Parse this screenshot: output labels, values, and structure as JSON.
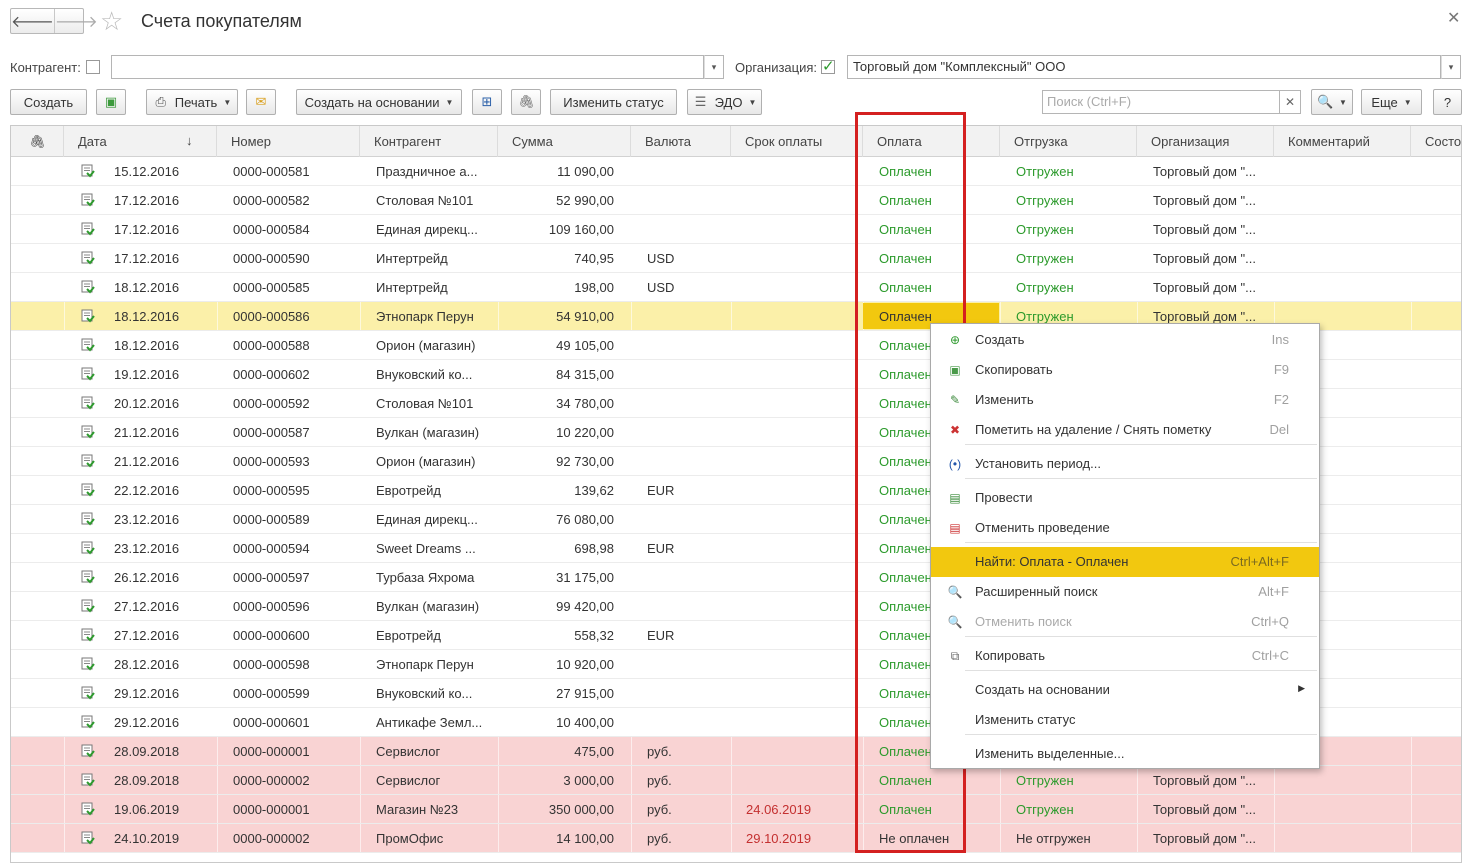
{
  "title": "Счета покупателям",
  "nav": {
    "back": "🡐",
    "forward": "🡒"
  },
  "filters": {
    "kontragent_label": "Контрагент:",
    "kontragent_value": "",
    "org_label": "Организация:",
    "org_value": "Торговый дом \"Комплексный\" ООО"
  },
  "toolbar": {
    "create": "Создать",
    "print": "Печать",
    "create_based": "Создать на основании",
    "change_status": "Изменить статус",
    "edo": "ЭДО",
    "search_placeholder": "Поиск (Ctrl+F)",
    "more": "Еще",
    "help": "?"
  },
  "columns": [
    "Дата",
    "Номер",
    "Контрагент",
    "Сумма",
    "Валюта",
    "Срок оплаты",
    "Оплата",
    "Отгрузка",
    "Организация",
    "Комментарий",
    "Состо"
  ],
  "sort_marker": "↓",
  "rows": [
    {
      "date": "15.12.2016",
      "num": "0000-000581",
      "kontr": "Праздничное а...",
      "sum": "11 090,00",
      "cur": "",
      "due": "",
      "pay": "Оплачен",
      "ship": "Отгружен",
      "org": "Торговый дом \"...",
      "style": ""
    },
    {
      "date": "17.12.2016",
      "num": "0000-000582",
      "kontr": "Столовая №101",
      "sum": "52 990,00",
      "cur": "",
      "due": "",
      "pay": "Оплачен",
      "ship": "Отгружен",
      "org": "Торговый дом \"...",
      "style": ""
    },
    {
      "date": "17.12.2016",
      "num": "0000-000584",
      "kontr": "Единая дирекц...",
      "sum": "109 160,00",
      "cur": "",
      "due": "",
      "pay": "Оплачен",
      "ship": "Отгружен",
      "org": "Торговый дом \"...",
      "style": ""
    },
    {
      "date": "17.12.2016",
      "num": "0000-000590",
      "kontr": "Интертрейд",
      "sum": "740,95",
      "cur": "USD",
      "due": "",
      "pay": "Оплачен",
      "ship": "Отгружен",
      "org": "Торговый дом \"...",
      "style": ""
    },
    {
      "date": "18.12.2016",
      "num": "0000-000585",
      "kontr": "Интертрейд",
      "sum": "198,00",
      "cur": "USD",
      "due": "",
      "pay": "Оплачен",
      "ship": "Отгружен",
      "org": "Торговый дом \"...",
      "style": ""
    },
    {
      "date": "18.12.2016",
      "num": "0000-000586",
      "kontr": "Этнопарк Перун",
      "sum": "54 910,00",
      "cur": "",
      "due": "",
      "pay": "Оплачен",
      "ship": "Отгружен",
      "org": "Торговый дом \"...",
      "style": "sel"
    },
    {
      "date": "18.12.2016",
      "num": "0000-000588",
      "kontr": "Орион (магазин)",
      "sum": "49 105,00",
      "cur": "",
      "due": "",
      "pay": "Оплачен",
      "ship": "",
      "org": "",
      "style": ""
    },
    {
      "date": "19.12.2016",
      "num": "0000-000602",
      "kontr": "Внуковский ко...",
      "sum": "84 315,00",
      "cur": "",
      "due": "",
      "pay": "Оплачен",
      "ship": "",
      "org": "",
      "style": ""
    },
    {
      "date": "20.12.2016",
      "num": "0000-000592",
      "kontr": "Столовая №101",
      "sum": "34 780,00",
      "cur": "",
      "due": "",
      "pay": "Оплачен",
      "ship": "",
      "org": "",
      "style": ""
    },
    {
      "date": "21.12.2016",
      "num": "0000-000587",
      "kontr": "Вулкан (магазин)",
      "sum": "10 220,00",
      "cur": "",
      "due": "",
      "pay": "Оплачен",
      "ship": "",
      "org": "",
      "style": ""
    },
    {
      "date": "21.12.2016",
      "num": "0000-000593",
      "kontr": "Орион (магазин)",
      "sum": "92 730,00",
      "cur": "",
      "due": "",
      "pay": "Оплачен",
      "ship": "",
      "org": "",
      "style": ""
    },
    {
      "date": "22.12.2016",
      "num": "0000-000595",
      "kontr": "Евротрейд",
      "sum": "139,62",
      "cur": "EUR",
      "due": "",
      "pay": "Оплачен",
      "ship": "",
      "org": "",
      "style": ""
    },
    {
      "date": "23.12.2016",
      "num": "0000-000589",
      "kontr": "Единая дирекц...",
      "sum": "76 080,00",
      "cur": "",
      "due": "",
      "pay": "Оплачен",
      "ship": "",
      "org": "",
      "style": ""
    },
    {
      "date": "23.12.2016",
      "num": "0000-000594",
      "kontr": "Sweet Dreams ...",
      "sum": "698,98",
      "cur": "EUR",
      "due": "",
      "pay": "Оплачен",
      "ship": "",
      "org": "",
      "style": ""
    },
    {
      "date": "26.12.2016",
      "num": "0000-000597",
      "kontr": "Турбаза Яхрома",
      "sum": "31 175,00",
      "cur": "",
      "due": "",
      "pay": "Оплачен",
      "ship": "",
      "org": "",
      "style": ""
    },
    {
      "date": "27.12.2016",
      "num": "0000-000596",
      "kontr": "Вулкан (магазин)",
      "sum": "99 420,00",
      "cur": "",
      "due": "",
      "pay": "Оплачен",
      "ship": "",
      "org": "",
      "style": ""
    },
    {
      "date": "27.12.2016",
      "num": "0000-000600",
      "kontr": "Евротрейд",
      "sum": "558,32",
      "cur": "EUR",
      "due": "",
      "pay": "Оплачен",
      "ship": "",
      "org": "",
      "style": ""
    },
    {
      "date": "28.12.2016",
      "num": "0000-000598",
      "kontr": "Этнопарк Перун",
      "sum": "10 920,00",
      "cur": "",
      "due": "",
      "pay": "Оплачен",
      "ship": "",
      "org": "",
      "style": ""
    },
    {
      "date": "29.12.2016",
      "num": "0000-000599",
      "kontr": "Внуковский ко...",
      "sum": "27 915,00",
      "cur": "",
      "due": "",
      "pay": "Оплачен",
      "ship": "",
      "org": "",
      "style": ""
    },
    {
      "date": "29.12.2016",
      "num": "0000-000601",
      "kontr": "Антикафе Земл...",
      "sum": "10 400,00",
      "cur": "",
      "due": "",
      "pay": "Оплачен",
      "ship": "",
      "org": "",
      "style": ""
    },
    {
      "date": "28.09.2018",
      "num": "0000-000001",
      "kontr": "Сервислог",
      "sum": "475,00",
      "cur": "руб.",
      "due": "",
      "pay": "Оплачен",
      "ship": "",
      "org": "",
      "style": "pink"
    },
    {
      "date": "28.09.2018",
      "num": "0000-000002",
      "kontr": "Сервислог",
      "sum": "3 000,00",
      "cur": "руб.",
      "due": "",
      "pay": "Оплачен",
      "ship": "Отгружен",
      "org": "Торговый дом \"...",
      "style": "pink"
    },
    {
      "date": "19.06.2019",
      "num": "0000-000001",
      "kontr": "Магазин №23",
      "sum": "350 000,00",
      "cur": "руб.",
      "due": "24.06.2019",
      "pay": "Оплачен",
      "ship": "Отгружен",
      "org": "Торговый дом \"...",
      "style": "pink"
    },
    {
      "date": "24.10.2019",
      "num": "0000-000002",
      "kontr": "ПромОфис",
      "sum": "14 100,00",
      "cur": "руб.",
      "due": "29.10.2019",
      "pay": "Не оплачен",
      "ship": "Не отгружен",
      "org": "Торговый дом \"...",
      "style": "pink"
    }
  ],
  "context_menu": [
    {
      "label": "Создать",
      "key": "Ins",
      "icon": "plus-circle-icon",
      "glyph": "⊕",
      "color": "#2e9a2e"
    },
    {
      "label": "Скопировать",
      "key": "F9",
      "icon": "copy-doc-icon",
      "glyph": "▣",
      "color": "#4a9a4a"
    },
    {
      "label": "Изменить",
      "key": "F2",
      "icon": "pencil-icon",
      "glyph": "✎",
      "color": "#3c8a3c"
    },
    {
      "label": "Пометить на удаление / Снять пометку",
      "key": "Del",
      "icon": "delete-mark-icon",
      "glyph": "✖",
      "color": "#cc3333"
    },
    {
      "label": "Установить период...",
      "key": "",
      "icon": "period-icon",
      "glyph": "(•)",
      "color": "#2255aa"
    },
    {
      "label": "Провести",
      "key": "",
      "icon": "post-icon",
      "glyph": "▤",
      "color": "#3a8a3a"
    },
    {
      "label": "Отменить проведение",
      "key": "",
      "icon": "unpost-icon",
      "glyph": "▤",
      "color": "#cc3333"
    },
    {
      "label": "Найти: Оплата - Оплачен",
      "key": "Ctrl+Alt+F",
      "icon": "",
      "glyph": "",
      "color": ""
    },
    {
      "label": "Расширенный поиск",
      "key": "Alt+F",
      "icon": "search-icon",
      "glyph": "🔍",
      "color": "#2255aa"
    },
    {
      "label": "Отменить поиск",
      "key": "Ctrl+Q",
      "icon": "cancel-search-icon",
      "glyph": "🔍",
      "color": "#999"
    },
    {
      "label": "Копировать",
      "key": "Ctrl+C",
      "icon": "copy-icon",
      "glyph": "⧉",
      "color": "#666"
    },
    {
      "label": "Создать на основании",
      "key": "",
      "icon": "",
      "glyph": "",
      "color": ""
    },
    {
      "label": "Изменить статус",
      "key": "",
      "icon": "",
      "glyph": "",
      "color": ""
    },
    {
      "label": "Изменить выделенные...",
      "key": "",
      "icon": "",
      "glyph": "",
      "color": ""
    }
  ],
  "submenu_arrow": "▶",
  "colors": {
    "highlight": "#f2c80f",
    "selected_row": "#fbf0a9",
    "overdue_row": "#f9d3d3",
    "paid_green": "#2b9a2b",
    "due_red": "#c43030",
    "annotation_red": "#d42020"
  }
}
